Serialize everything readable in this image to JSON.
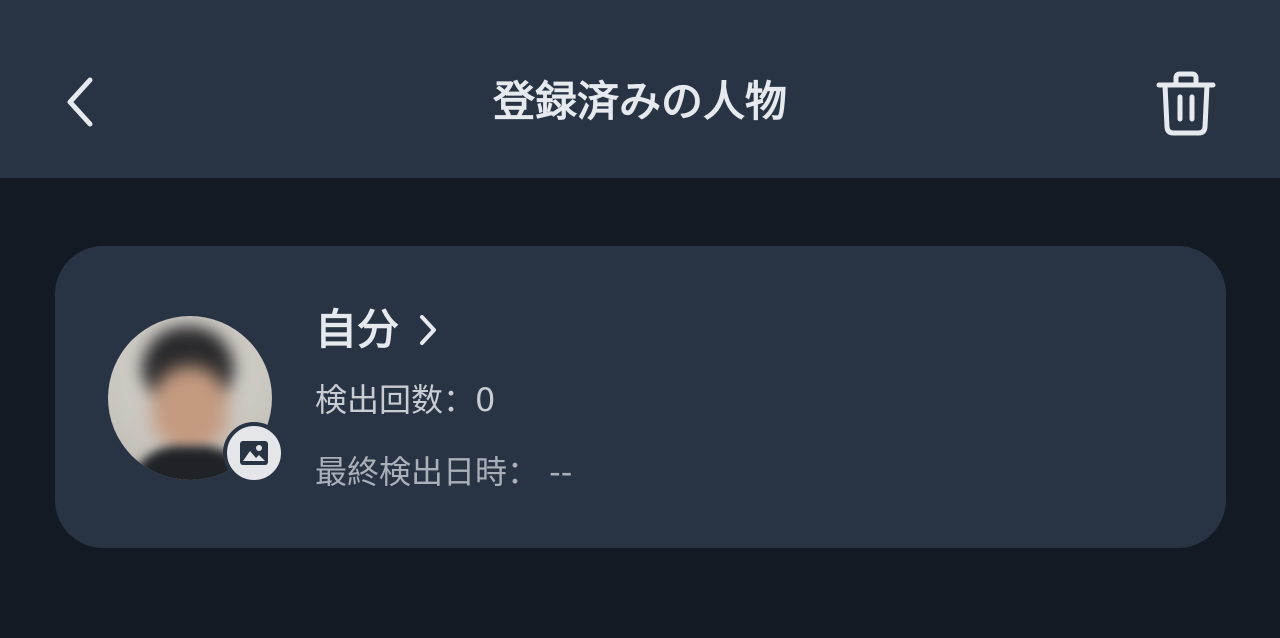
{
  "header": {
    "title": "登録済みの人物"
  },
  "person": {
    "name": "自分",
    "detection_count_label": "検出回数：0",
    "last_detection_label": "最終検出日時： --"
  },
  "colors": {
    "header_bg": "#283344",
    "page_bg": "#131a24",
    "card_bg": "#283344",
    "text_primary": "#e6e9ee",
    "text_secondary": "#c8ccd3"
  },
  "icons": {
    "back": "chevron-left-icon",
    "delete": "trash-icon",
    "name_link": "chevron-right-icon",
    "photo": "image-icon"
  }
}
